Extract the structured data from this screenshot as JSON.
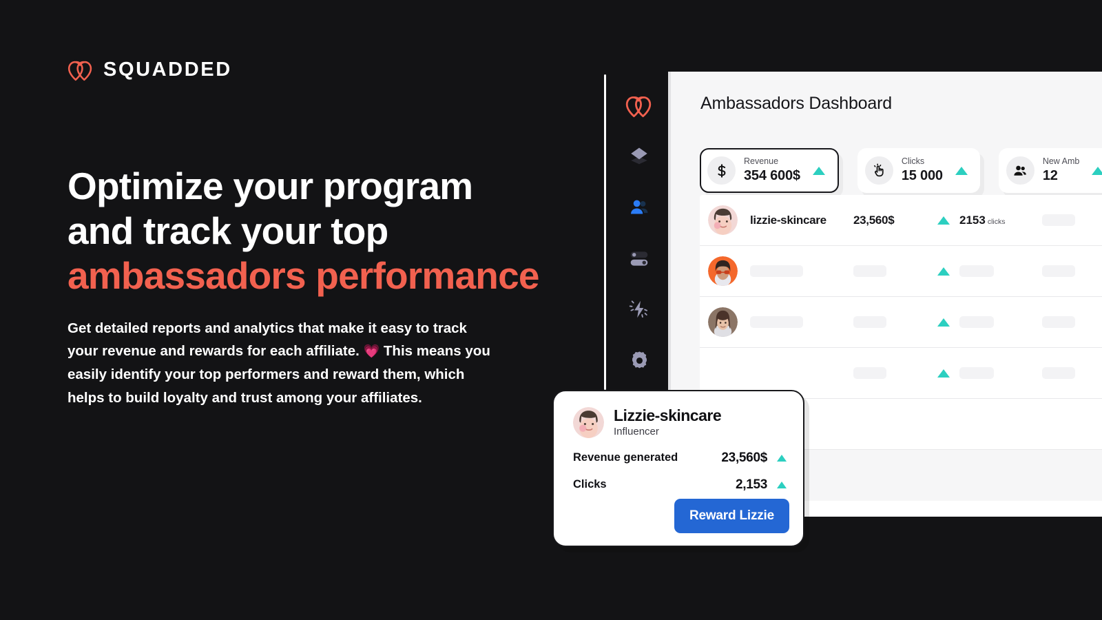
{
  "brand": {
    "name": "SQUADDED",
    "logo_icon": "squadded-hearts-logo"
  },
  "hero": {
    "headline_line1": "Optimize your program",
    "headline_line2": "and track your top",
    "headline_accent": "ambassadors performance",
    "accent_color": "#f2614f",
    "body_before_emoji": "Get detailed reports and analytics that make it easy to track your revenue and rewards for each affiliate.",
    "body_emoji": "💗",
    "body_after_emoji": "This means you easily identify your top performers and reward them, which helps to build loyalty and trust among your affiliates."
  },
  "sidebar": {
    "items": [
      {
        "icon": "squadded-hearts-logo-icon",
        "name": "logo",
        "active": false
      },
      {
        "icon": "layers-icon",
        "name": "layers",
        "active": false
      },
      {
        "icon": "people-icon",
        "name": "ambassadors",
        "active": true
      },
      {
        "icon": "toggles-icon",
        "name": "settings-toggles",
        "active": false
      },
      {
        "icon": "lightning-icon",
        "name": "automations",
        "active": false
      },
      {
        "icon": "gear-icon",
        "name": "settings",
        "active": false
      }
    ]
  },
  "dashboard": {
    "title": "Ambassadors Dashboard",
    "stats": [
      {
        "icon": "dollar-icon",
        "label": "Revenue",
        "value": "354 600$",
        "trend": "up",
        "selected": true
      },
      {
        "icon": "click-hand-icon",
        "label": "Clicks",
        "value": "15 000",
        "trend": "up",
        "selected": false
      },
      {
        "icon": "people-icon",
        "label": "New Amb",
        "value": "12",
        "trend": "up",
        "selected": false
      }
    ],
    "table": {
      "rows": [
        {
          "avatar": "avatar-lizzie",
          "name": "lizzie-skincare",
          "revenue": "23,560$",
          "revenue_trend": "up",
          "clicks": "2153",
          "clicks_unit": "clicks",
          "placeholder": false
        },
        {
          "avatar": "avatar-orange",
          "placeholder": true,
          "revenue_trend": "up",
          "last_trend": "down"
        },
        {
          "avatar": "avatar-brunette",
          "placeholder": true,
          "revenue_trend": "up",
          "last_trend": "down"
        },
        {
          "avatar": "avatar-hidden",
          "placeholder": true,
          "revenue_trend": "up",
          "last_trend": "down"
        }
      ]
    }
  },
  "popup": {
    "avatar": "avatar-lizzie",
    "name": "Lizzie-skincare",
    "role": "Influencer",
    "metrics": [
      {
        "label": "Revenue generated",
        "value": "23,560$",
        "trend": "up"
      },
      {
        "label": "Clicks",
        "value": "2,153",
        "trend": "up"
      }
    ],
    "button_label": "Reward Lizzie",
    "button_color": "#2467d4"
  },
  "colors": {
    "background": "#131315",
    "accent_red": "#f2614f",
    "trend_up": "#2ccfc0",
    "trend_down": "#f9626f",
    "active_blue": "#2b7cf6"
  }
}
